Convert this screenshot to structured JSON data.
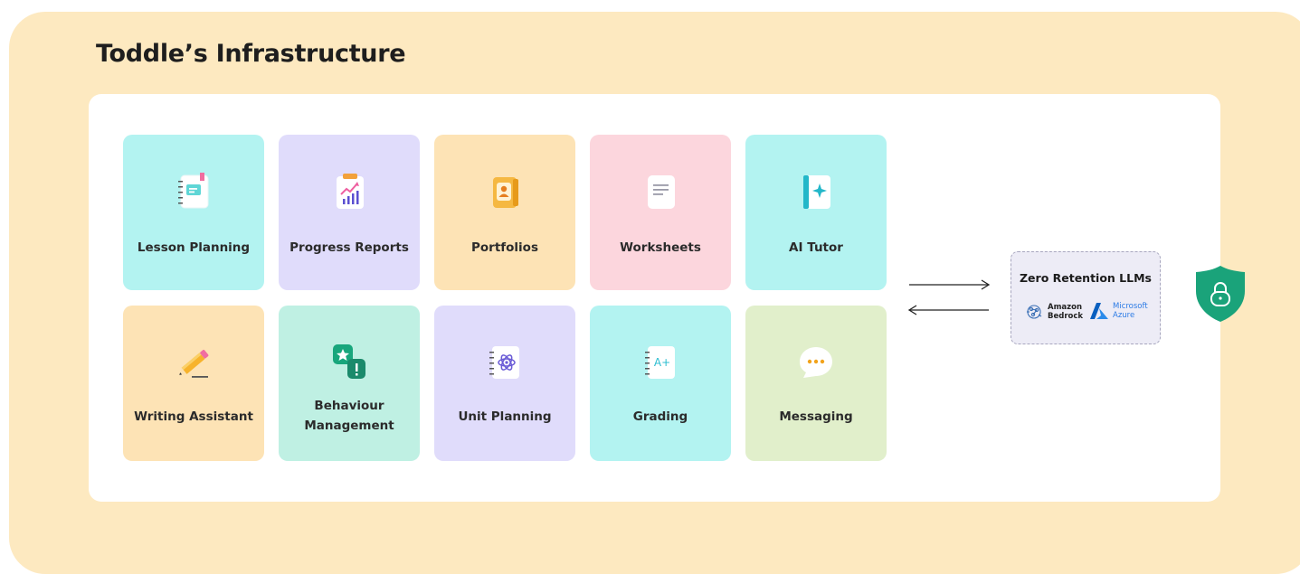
{
  "title": "Toddle’s Infrastructure",
  "tiles": [
    {
      "label": "Lesson Planning",
      "icon": "lesson-planning-notebook-icon",
      "color": "#b3f3f1"
    },
    {
      "label": "Progress Reports",
      "icon": "progress-report-chart-icon",
      "color": "#e0dcfb"
    },
    {
      "label": "Portfolios",
      "icon": "portfolio-contact-icon",
      "color": "#fde3b5"
    },
    {
      "label": "Worksheets",
      "icon": "worksheet-document-icon",
      "color": "#fcd6dd"
    },
    {
      "label": "AI Tutor",
      "icon": "ai-tutor-sparkle-icon",
      "color": "#b3f3f1"
    },
    {
      "label": "Writing Assistant",
      "icon": "pencil-icon",
      "color": "#fde3b5"
    },
    {
      "label": "Behaviour Management",
      "icon": "behaviour-badge-icon",
      "color": "#bff0e3"
    },
    {
      "label": "Unit Planning",
      "icon": "unit-planning-atom-icon",
      "color": "#e0dcfb"
    },
    {
      "label": "Grading",
      "icon": "grading-a-plus-icon",
      "color": "#b3f3f1"
    },
    {
      "label": "Messaging",
      "icon": "messaging-chat-icon",
      "color": "#e1efcb"
    }
  ],
  "llm": {
    "title": "Zero Retention LLMs",
    "providers": [
      {
        "line1": "Amazon",
        "line2": "Bedrock",
        "icon": "amazon-bedrock-icon"
      },
      {
        "line1": "Microsoft",
        "line2": "Azure",
        "icon": "microsoft-azure-icon"
      }
    ]
  },
  "security_icon": "shield-lock-icon",
  "colors": {
    "background": "#fde9c0",
    "panel": "#ffffff",
    "shield": "#1aa37a",
    "azure": "#2c7be5"
  }
}
